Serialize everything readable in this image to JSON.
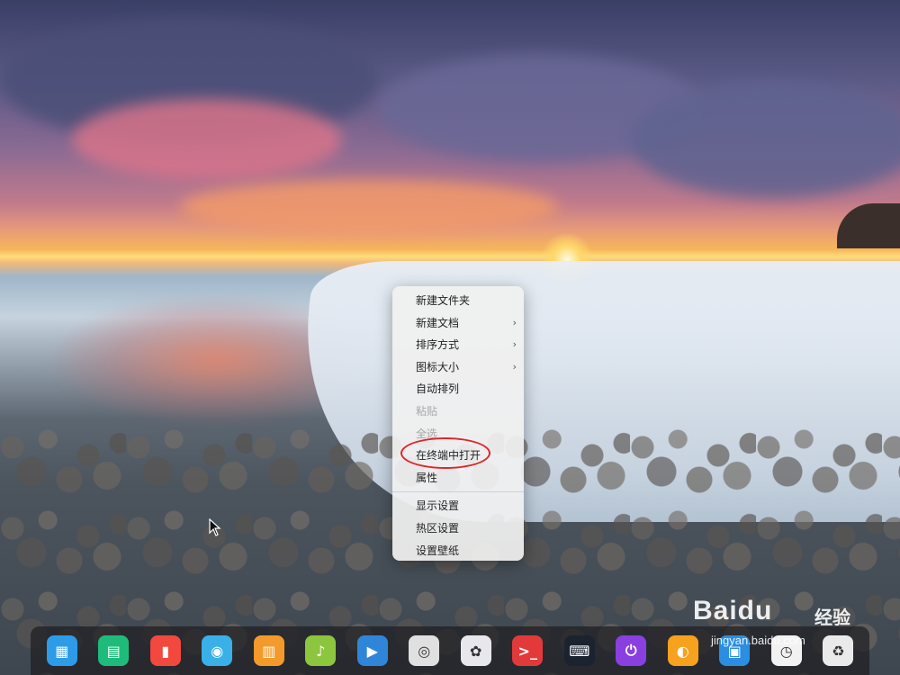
{
  "desktop": {
    "context_menu": {
      "items": [
        {
          "label": "新建文件夹",
          "submenu": false,
          "disabled": false
        },
        {
          "label": "新建文档",
          "submenu": true,
          "disabled": false
        },
        {
          "label": "排序方式",
          "submenu": true,
          "disabled": false
        },
        {
          "label": "图标大小",
          "submenu": true,
          "disabled": false
        },
        {
          "label": "自动排列",
          "submenu": false,
          "disabled": false
        },
        {
          "label": "粘贴",
          "submenu": false,
          "disabled": true
        },
        {
          "label": "全选",
          "submenu": false,
          "disabled": true
        },
        {
          "label": "在终端中打开",
          "submenu": false,
          "disabled": false,
          "highlighted": true
        },
        {
          "label": "属性",
          "submenu": false,
          "disabled": false
        },
        {
          "label": "显示设置",
          "submenu": false,
          "disabled": false
        },
        {
          "label": "热区设置",
          "submenu": false,
          "disabled": false
        },
        {
          "label": "设置壁纸",
          "submenu": false,
          "disabled": false
        }
      ],
      "submenu_arrow": "›"
    }
  },
  "dock": {
    "items": [
      {
        "name": "launcher-icon",
        "color": "#2e9be8",
        "glyph": "▦"
      },
      {
        "name": "file-manager-icon",
        "color": "#1ebc7a",
        "glyph": "▤"
      },
      {
        "name": "video-app-icon",
        "color": "#f2483e",
        "glyph": "▮"
      },
      {
        "name": "app-store-icon",
        "color": "#3ab0e8",
        "glyph": "◉"
      },
      {
        "name": "shopping-bag-icon",
        "color": "#f49a2b",
        "glyph": "▥"
      },
      {
        "name": "music-player-icon",
        "color": "#8cc63e",
        "glyph": "♪"
      },
      {
        "name": "movie-player-icon",
        "color": "#2f86d9",
        "glyph": "▶"
      },
      {
        "name": "chrome-browser-icon",
        "color": "#e0e0e0",
        "glyph": "◎"
      },
      {
        "name": "settings-icon",
        "color": "#e8e8ec",
        "glyph": "✿"
      },
      {
        "name": "terminal-icon",
        "color": "#e23a3a",
        "glyph": ">_"
      },
      {
        "name": "keyboard-icon",
        "color": "#1b2330",
        "glyph": "⌨"
      },
      {
        "name": "power-icon",
        "color": "#8a3fe0",
        "glyph": "⏻"
      },
      {
        "name": "clock-widget-icon",
        "color": "#f6a21e",
        "glyph": "◐"
      },
      {
        "name": "image-viewer-icon",
        "color": "#2b8ee0",
        "glyph": "▣"
      },
      {
        "name": "clock-icon",
        "color": "#f2f2f2",
        "glyph": "◷"
      },
      {
        "name": "trash-icon",
        "color": "#eaeaea",
        "glyph": "♻"
      }
    ]
  },
  "watermark": {
    "brand": "Baidu",
    "sub": "经验",
    "url": "jingyan.baidu.com"
  },
  "colors": {
    "menu_bg": "#f0f0f0",
    "highlight_ring": "#e0242a",
    "dock_bg": "#1e1e22"
  }
}
